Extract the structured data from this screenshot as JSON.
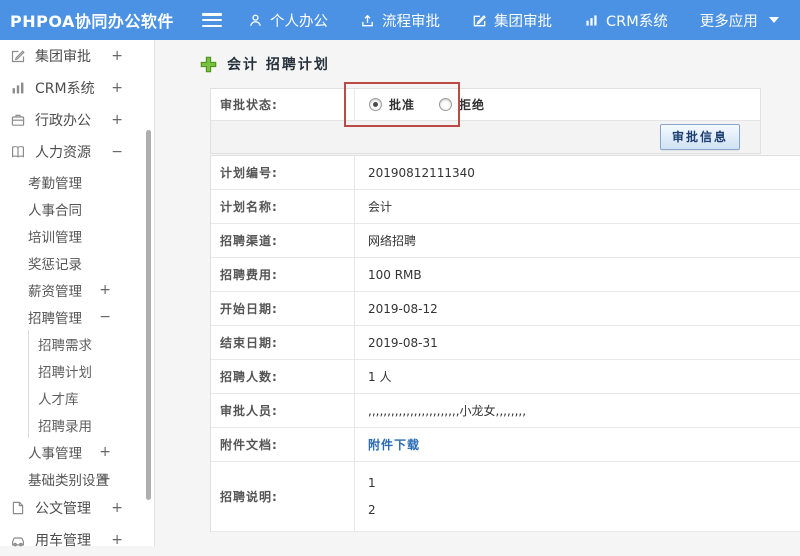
{
  "header": {
    "logo": "PHPOA协同办公软件",
    "nav": [
      {
        "id": "personal-office",
        "icon": "user-icon",
        "label": "个人办公"
      },
      {
        "id": "process-approval",
        "icon": "upload-icon",
        "label": "流程审批"
      },
      {
        "id": "group-approval",
        "icon": "edit-square-icon",
        "label": "集团审批"
      },
      {
        "id": "crm-system",
        "icon": "bar-chart-icon",
        "label": "CRM系统"
      },
      {
        "id": "more-apps",
        "icon": "",
        "label": "更多应用",
        "caret": true
      }
    ]
  },
  "sidebar": {
    "items": [
      {
        "id": "group-approval",
        "label": "集团审批",
        "level": 1,
        "icon": "edit-square-icon",
        "toggle": "+"
      },
      {
        "id": "crm-system",
        "label": "CRM系统",
        "level": 1,
        "icon": "bar-chart-icon",
        "toggle": "+"
      },
      {
        "id": "admin-office",
        "label": "行政办公",
        "level": 1,
        "icon": "briefcase-icon",
        "toggle": "+"
      },
      {
        "id": "human-resources",
        "label": "人力资源",
        "level": 1,
        "icon": "book-icon",
        "toggle": "−"
      },
      {
        "id": "attendance",
        "label": "考勤管理",
        "level": 2
      },
      {
        "id": "hr-contract",
        "label": "人事合同",
        "level": 2
      },
      {
        "id": "training",
        "label": "培训管理",
        "level": 2
      },
      {
        "id": "rewards",
        "label": "奖惩记录",
        "level": 2
      },
      {
        "id": "salary",
        "label": "薪资管理",
        "level": 2,
        "toggle": "+"
      },
      {
        "id": "recruitment",
        "label": "招聘管理",
        "level": 2,
        "toggle": "−"
      },
      {
        "id": "recruit-demand",
        "label": "招聘需求",
        "level": 3
      },
      {
        "id": "recruit-plan",
        "label": "招聘计划",
        "level": 3
      },
      {
        "id": "talent-pool",
        "label": "人才库",
        "level": 3
      },
      {
        "id": "recruit-hire",
        "label": "招聘录用",
        "level": 3
      },
      {
        "id": "personnel",
        "label": "人事管理",
        "level": 2,
        "toggle": "+"
      },
      {
        "id": "base-category",
        "label": "基础类别设置",
        "level": 2,
        "toggle": "+"
      },
      {
        "id": "documents",
        "label": "公文管理",
        "level": 1,
        "icon": "document-icon",
        "toggle": "+"
      },
      {
        "id": "vehicles",
        "label": "用车管理",
        "level": 1,
        "icon": "car-icon",
        "toggle": "+"
      }
    ]
  },
  "main": {
    "title": "会计 招聘计划",
    "approval": {
      "label": "审批状态:",
      "options": [
        {
          "label": "批准",
          "checked": true
        },
        {
          "label": "拒绝",
          "checked": false
        }
      ],
      "button": "审批信息"
    },
    "fields": [
      {
        "label": "计划编号:",
        "value": "20190812111340"
      },
      {
        "label": "计划名称:",
        "value": "会计"
      },
      {
        "label": "招聘渠道:",
        "value": "网络招聘"
      },
      {
        "label": "招聘费用:",
        "value": "100 RMB"
      },
      {
        "label": "开始日期:",
        "value": "2019-08-12"
      },
      {
        "label": "结束日期:",
        "value": "2019-08-31"
      },
      {
        "label": "招聘人数:",
        "value": "1 人"
      },
      {
        "label": "审批人员:",
        "value": ",,,,,,,,,,,,,,,,,,,,,,,,小龙女,,,,,,,,"
      },
      {
        "label": "附件文档:",
        "value": "附件下载",
        "link": true
      },
      {
        "label": "招聘说明:",
        "lines": [
          "1",
          "2"
        ],
        "tall": true
      }
    ]
  },
  "colors": {
    "header_blue": "#4b92e5",
    "annotation_red": "#bc4b47",
    "link_blue": "#2a6cb5",
    "button_text_blue": "#1d3f72",
    "plus_green": "#67b021"
  }
}
